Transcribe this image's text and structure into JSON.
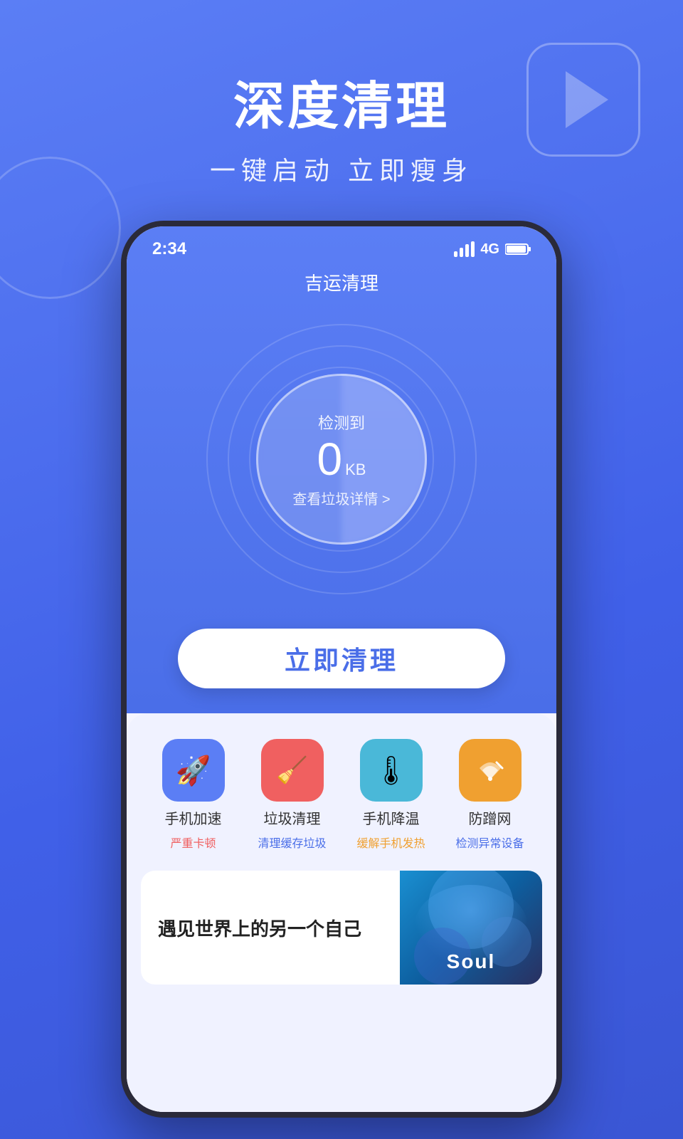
{
  "header": {
    "main_title": "深度清理",
    "sub_title": "一键启动 立即瘦身"
  },
  "phone": {
    "status_bar": {
      "time": "2:34",
      "network": "4G"
    },
    "app_title": "吉运清理",
    "gauge": {
      "label": "检测到",
      "value": "0",
      "unit": "KB",
      "detail": "查看垃圾详情 >"
    },
    "clean_button": "立即清理",
    "features": [
      {
        "icon": "🚀",
        "icon_class": "icon-blue",
        "name": "手机加速",
        "status": "严重卡顿",
        "status_class": "status-red"
      },
      {
        "icon": "🧹",
        "icon_class": "icon-red",
        "name": "垃圾清理",
        "status": "清理缓存垃圾",
        "status_class": "status-blue"
      },
      {
        "icon": "🌡",
        "icon_class": "icon-cyan",
        "name": "手机降温",
        "status": "缓解手机发热",
        "status_class": "status-orange"
      },
      {
        "icon": "📶",
        "icon_class": "icon-orange",
        "name": "防蹭网",
        "status": "检测异常设备",
        "status_class": "status-blue"
      }
    ],
    "ad": {
      "title": "遇见世界上的另一个自己",
      "brand": "Soul"
    }
  }
}
